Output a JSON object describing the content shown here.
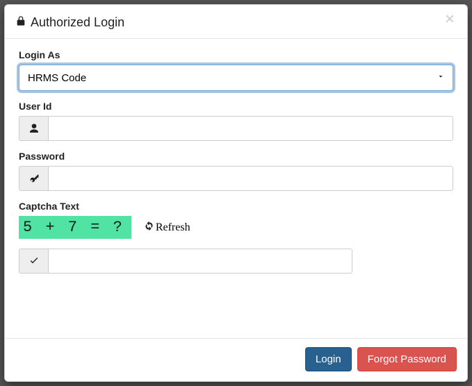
{
  "header": {
    "title": "Authorized Login"
  },
  "form": {
    "loginAs": {
      "label": "Login As",
      "selected": "HRMS Code"
    },
    "userId": {
      "label": "User Id",
      "value": ""
    },
    "password": {
      "label": "Password",
      "value": ""
    },
    "captcha": {
      "label": "Captcha Text",
      "challenge": "5 + 7 = ?",
      "refresh": "Refresh",
      "value": ""
    }
  },
  "footer": {
    "login": "Login",
    "forgot": "Forgot Password"
  }
}
